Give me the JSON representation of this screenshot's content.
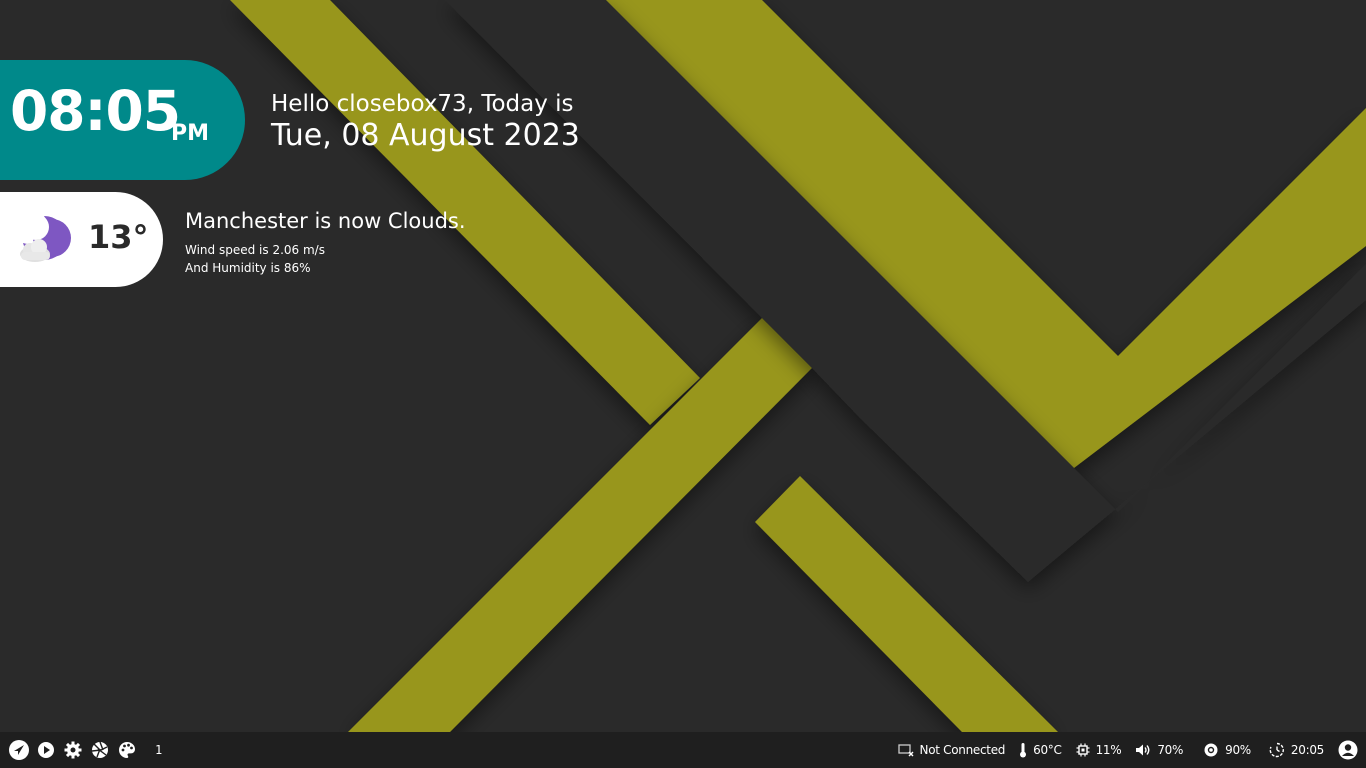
{
  "colors": {
    "background": "#2a2a2a",
    "stripe": "#98961c",
    "clock_accent": "#00898a",
    "weather_icon": "#7e57c2",
    "taskbar": "#1f1f1f"
  },
  "clock": {
    "time": "08:05",
    "ampm": "PM"
  },
  "greeting": {
    "line1": "Hello closebox73, Today is",
    "date": "Tue, 08 August 2023"
  },
  "weather": {
    "icon": "moon-cloud-icon",
    "temperature": "13°",
    "summary": "Manchester is now Clouds.",
    "wind": "Wind speed is 2.06 m/s",
    "humidity": "And Humidity is 86%"
  },
  "taskbar": {
    "left_icons": [
      "launcher-icon",
      "play-icon",
      "gear-icon",
      "aperture-icon",
      "palette-icon"
    ],
    "workspace": "1",
    "network": "Not Connected",
    "temperature": "60°C",
    "cpu": "11%",
    "volume": "70%",
    "brightness": "90%",
    "clock": "20:05"
  }
}
